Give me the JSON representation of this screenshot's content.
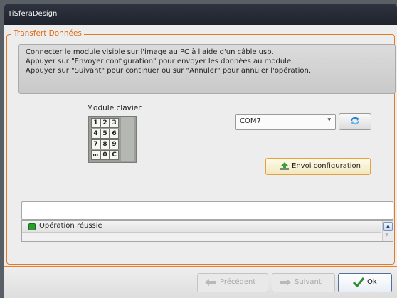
{
  "window": {
    "title": "TiSferaDesign"
  },
  "group": {
    "title": "Transfert Données"
  },
  "info": {
    "lines": [
      "Connecter le module visible sur l'image au PC à l'aide d'un câble usb.",
      "Appuyer sur \"Envoyer configuration\" pour envoyer les données au module.",
      "Appuyer sur \"Suivant\" pour continuer ou sur \"Annuler\" pour annuler l'opération."
    ]
  },
  "module": {
    "label": "Module clavier",
    "keys": [
      "1",
      "2",
      "3",
      "4",
      "5",
      "6",
      "7",
      "8",
      "9",
      "o-",
      "0",
      "C"
    ]
  },
  "port": {
    "selected": "COM7",
    "arrow": "▾"
  },
  "refresh": {
    "icon": "refresh-icon"
  },
  "send": {
    "label": "Envoi configuration",
    "icon": "upload-icon"
  },
  "output": {
    "value": ""
  },
  "status": {
    "text": "Opération réussie",
    "state_color": "#2f9a2f"
  },
  "nav": {
    "prev_label": "Précédent",
    "next_label": "Suivant",
    "ok_label": "Ok"
  },
  "colors": {
    "accent": "#e27a25",
    "titlebar": "#262a33",
    "ok_check": "#2e8b2e"
  }
}
